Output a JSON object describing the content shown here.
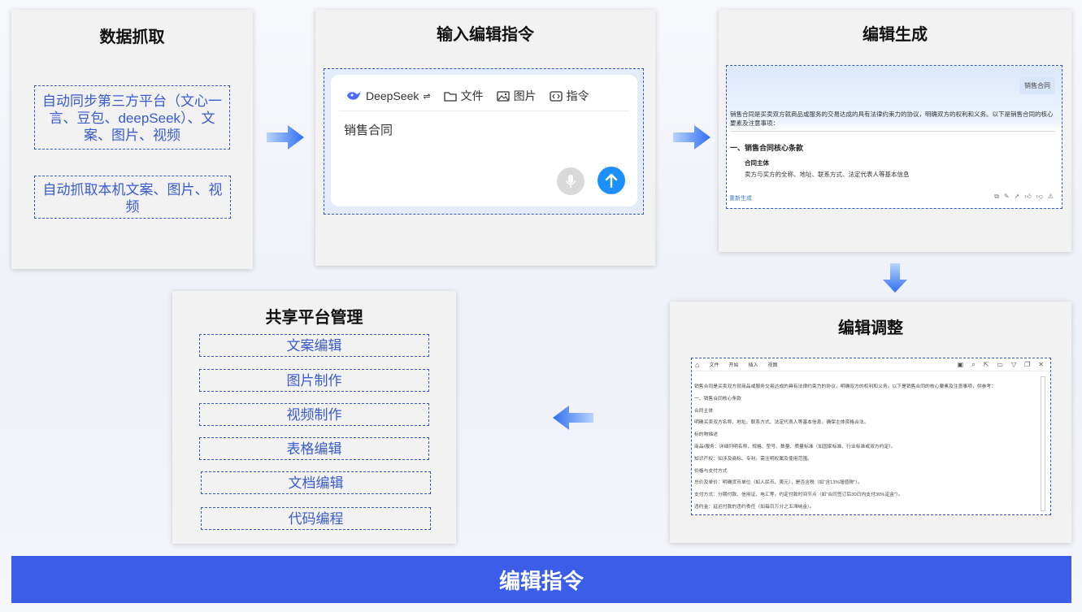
{
  "panels": {
    "capture": {
      "title": "数据抓取",
      "items": [
        "自动同步第三方平台（文心一言、豆包、deepSeek）、文案、图片、视频",
        "自动抓取本机文案、图片、视频"
      ]
    },
    "input": {
      "title": "输入编辑指令",
      "toolbar": {
        "model": "DeepSeek",
        "switch_glyph": "⇌",
        "file": "文件",
        "image": "图片",
        "command": "指令"
      },
      "text": "销售合同"
    },
    "generate": {
      "title": "编辑生成",
      "chip": "销售合同",
      "intro": "销售合同是买卖双方就商品或服务的交易达成的具有法律约束力的协议，明确双方的权利和义务。以下是销售合同的核心要素及注意事项：",
      "heading": "一、销售合同核心条款",
      "subheading": "合同主体",
      "description": "卖方与买方的全称、地址、联系方式、法定代表人等基本信息",
      "regenerate": "重新生成"
    },
    "adjust": {
      "title": "编辑调整",
      "menu": [
        "文件",
        "开始",
        "插入",
        "视图"
      ],
      "lines": [
        "销售合同是买卖双方就商品或服务交易达成的具有法律约束力的协议，明确双方的权利和义务。以下是销售合同的核心要素及注意事项，供参考：",
        "一、销售合同核心条款",
        "合同主体",
        "明确买卖双方名称、地址、联系方式、法定代表人等基本信息，确保主体资格合法。",
        "标的物描述",
        "商品/服务：详细列明名称、规格、型号、数量、质量标准（如国家标准、行业标准或双方约定）。",
        "知识产权：如涉及商标、专利，需注明权属及使用范围。",
        "价格与支付方式",
        "总价及单价：明确货币单位（如人民币、美元），是否含税（如“含13%增值税”）。",
        "支付方式：分期付款、信用证、电汇等，约定付款时间节点（如“合同签订后30日内支付30%定金”）。",
        "违约金：延迟付款的违约责任（如每日万分之五滞纳金）。"
      ]
    },
    "share": {
      "title": "共享平台管理",
      "items": [
        "文案编辑",
        "图片制作",
        "视频制作",
        "表格编辑",
        "文档编辑",
        "代码编程"
      ]
    }
  },
  "footer": {
    "title": "编辑指令"
  },
  "colors": {
    "accent": "#3b5de7",
    "dash": "#3558c9",
    "arrow": "#3b82f6",
    "send": "#1e8fff"
  }
}
